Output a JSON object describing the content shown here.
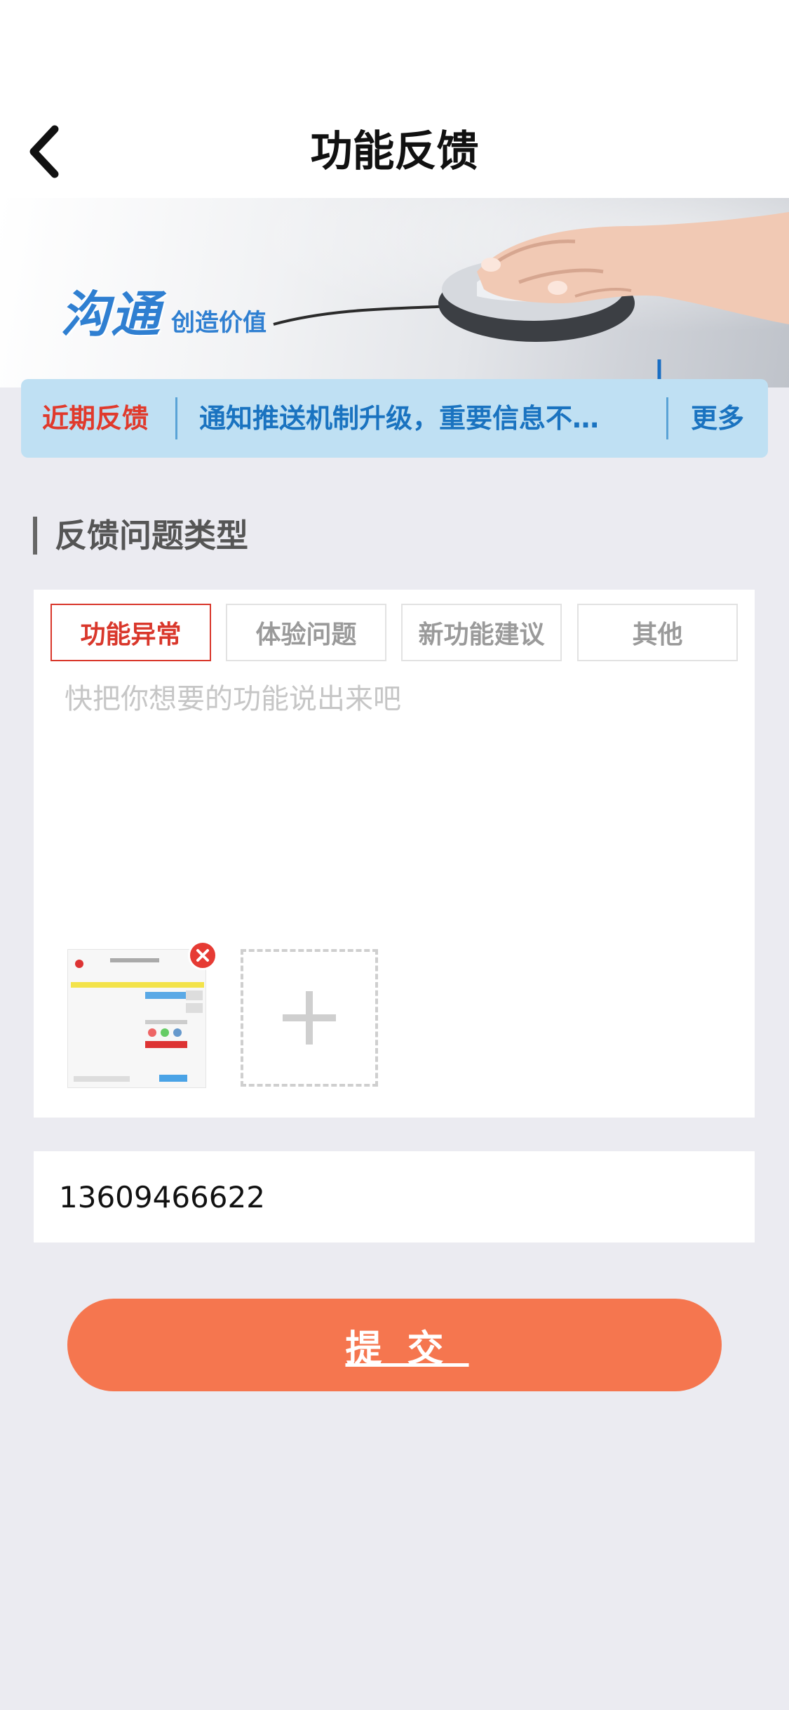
{
  "header": {
    "title": "功能反馈"
  },
  "banner": {
    "headline": "沟通",
    "tagline": "创造价值"
  },
  "notice": {
    "label": "近期反馈",
    "text": "通知推送机制升级，重要信息不…",
    "more": "更多"
  },
  "section": {
    "title": "反馈问题类型"
  },
  "feedback_types": [
    {
      "label": "功能异常",
      "selected": true
    },
    {
      "label": "体验问题",
      "selected": false
    },
    {
      "label": "新功能建议",
      "selected": false
    },
    {
      "label": "其他",
      "selected": false
    }
  ],
  "feedback": {
    "placeholder": "快把你想要的功能说出来吧",
    "value": ""
  },
  "attachments": {
    "count": 1
  },
  "contact": {
    "phone": "13609466622"
  },
  "submit": {
    "label": "提交"
  },
  "colors": {
    "accent": "#f5764f",
    "selected_tab": "#d9372b",
    "notice_bg": "#bfe0f3",
    "notice_text": "#1a73c0"
  },
  "icons": {
    "back": "chevron-left-icon",
    "remove": "close-circle-icon",
    "add": "plus-icon"
  }
}
